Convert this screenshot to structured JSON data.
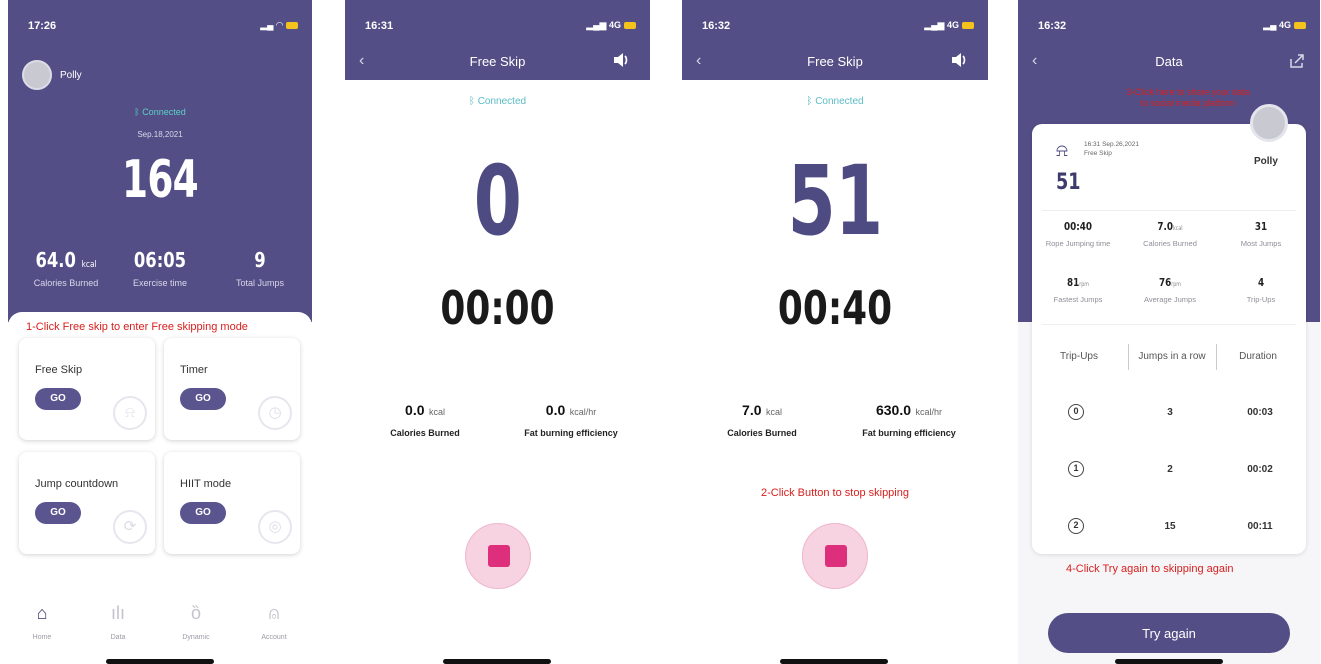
{
  "colors": {
    "primary_purple": "#534f86",
    "stop_pink": "#de2f7d",
    "connected_teal": "#5bbcc6",
    "note_red": "#d6201e"
  },
  "screen1": {
    "status_time": "17:26",
    "user_name": "Polly",
    "connected": "Connected",
    "date": "Sep.18,2021",
    "total_count": "164",
    "stats": [
      {
        "value": "64.0",
        "unit": "kcal",
        "label": "Calories Burned"
      },
      {
        "value": "06:05",
        "unit": "",
        "label": "Exercise time"
      },
      {
        "value": "9",
        "unit": "",
        "label": "Total Jumps"
      }
    ],
    "note": "1-Click Free skip to enter Free skipping mode",
    "modes": [
      {
        "title": "Free Skip",
        "button": "GO",
        "icon": "skip-rope-icon"
      },
      {
        "title": "Timer",
        "button": "GO",
        "icon": "timer-icon"
      },
      {
        "title": "Jump countdown",
        "button": "GO",
        "icon": "countdown-icon"
      },
      {
        "title": "HIIT mode",
        "button": "GO",
        "icon": "hiit-icon"
      }
    ],
    "tabs": [
      {
        "label": "Home",
        "icon": "home-icon",
        "active": true
      },
      {
        "label": "Data",
        "icon": "bar-chart-icon",
        "active": false
      },
      {
        "label": "Dynamic",
        "icon": "medal-icon",
        "active": false
      },
      {
        "label": "Account",
        "icon": "person-icon",
        "active": false
      }
    ]
  },
  "screen2": {
    "status_time": "16:31",
    "network": "4G",
    "title": "Free Skip",
    "connected": "Connected",
    "count": "0",
    "timer": "00:00",
    "calories_value": "0.0",
    "calories_unit": "kcal",
    "calories_label": "Calories Burned",
    "efficiency_value": "0.0",
    "efficiency_unit": "kcal/hr",
    "efficiency_label": "Fat burning efficiency"
  },
  "screen3": {
    "status_time": "16:32",
    "network": "4G",
    "title": "Free Skip",
    "connected": "Connected",
    "count": "51",
    "timer": "00:40",
    "calories_value": "7.0",
    "calories_unit": "kcal",
    "calories_label": "Calories Burned",
    "efficiency_value": "630.0",
    "efficiency_unit": "kcal/hr",
    "efficiency_label": "Fat burning efficiency",
    "note": "2-Click Button to stop skipping"
  },
  "screen4": {
    "status_time": "16:32",
    "network": "4G",
    "title": "Data",
    "share_note_line1": "3-Click here to share your data",
    "share_note_line2": "to social media platform",
    "session_datetime": "16:31 Sep.26,2021",
    "session_mode": "Free Skip",
    "session_count": "51",
    "user_name": "Polly",
    "metrics": [
      {
        "value": "00:40",
        "unit": "",
        "label": "Rope Jumping time"
      },
      {
        "value": "7.0",
        "unit": "kcal",
        "label": "Calories Burned"
      },
      {
        "value": "31",
        "unit": "",
        "label": "Most Jumps"
      },
      {
        "value": "81",
        "unit": "rpm",
        "label": "Fastest Jumps"
      },
      {
        "value": "76",
        "unit": "rpm",
        "label": "Average Jumps"
      },
      {
        "value": "4",
        "unit": "",
        "label": "Trip-Ups"
      }
    ],
    "table_headers": [
      "Trip-Ups",
      "Jumps in a row",
      "Duration"
    ],
    "table_rows": [
      {
        "trip": "0",
        "jumps": "3",
        "duration": "00:03"
      },
      {
        "trip": "1",
        "jumps": "2",
        "duration": "00:02"
      },
      {
        "trip": "2",
        "jumps": "15",
        "duration": "00:11"
      }
    ],
    "note": "4-Click Try again to skipping again",
    "try_again": "Try again"
  }
}
